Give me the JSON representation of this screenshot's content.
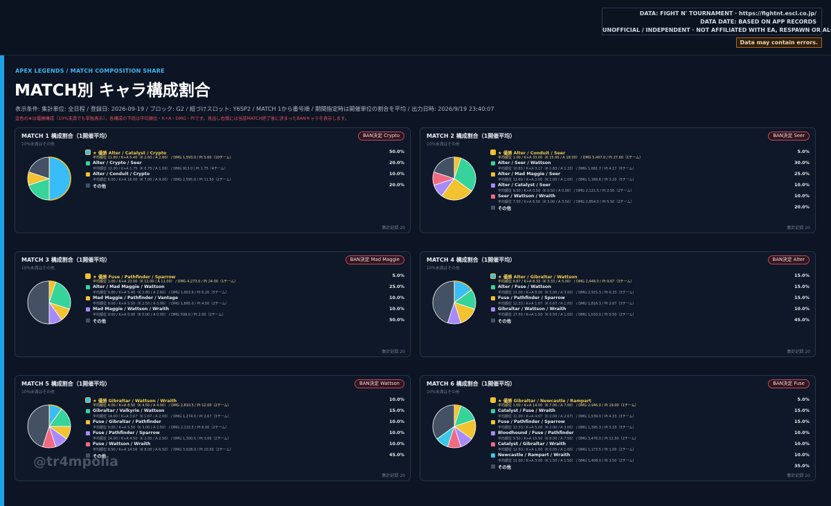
{
  "header": {
    "credit_lines": [
      "DATA: FIGHT N' TOURNAMENT · https://fightnt.escl.co.jp/",
      "DATA DATE: BASED ON APP RECORDS",
      "UNOFFICIAL / INDEPENDENT · NOT AFFILIATED WITH EA, RESPAWN OR ALGS"
    ],
    "warning": "Data may contain errors.",
    "eyebrow": "APEX LEGENDS / MATCH COMPOSITION SHARE",
    "title": "MATCH別 キャラ構成割合",
    "conditions": "表示条件: 集計単位: 全日程 / 登録日: 2026-09-19 / ブロック: G2 / 紐づけスロット: Y6SP2 / MATCH 1から番号順 / 期間指定時は開催単位の割合を平均 / 出力日時: 2026/9/19 23:40:07",
    "note": "金色の★は優勝構成（10%未満でも単独表示）。各構成の下段は平均順位・K+A・DMG・Ptです。見出し右側には当該MATCH終了後に決まったBANキャラを表示します。"
  },
  "watermark": "@tr4mpolia",
  "colors": {
    "winner": "#f2c230",
    "other": "#445164",
    "slice_border": "#ffffff",
    "c1": "#36d39a",
    "c2": "#f2c230",
    "c3": "#a78bfa",
    "c4": "#f06a82",
    "c5": "#3bc7e6",
    "sky": "#38bdf8"
  },
  "chart_data": [
    {
      "type": "pie",
      "title": "MATCH 1 構成割合（1開催平均）",
      "subtitle": "10%未満はその他",
      "ban": "BAN決定  Crypto",
      "footer": "集計記録 20",
      "slices": [
        {
          "label": "★ 優勝  Alter / Catalyst / Crypto",
          "stats": "平均順位 11.80 / K+A 5.40（K 2.60 / A 2.80） / DMG 1,593.0 / Pt 5.60（10チーム）",
          "pct_text": "50.0%",
          "value": 50,
          "color": "sky",
          "winner": true
        },
        {
          "label": "Alter / Crypto / Seer",
          "stats": "平均順位 12.00 / K+A 1.75（K 0.75 / A 1.00） / DMG 913.0 / Pt 1.75（4チーム）",
          "pct_text": "20.0%",
          "value": 20,
          "color": "c1"
        },
        {
          "label": "Alter / Conduit / Crypto",
          "stats": "平均順位 6.00 / K+A 16.00（K 7.00 / A 9.00） / DMG 2,595.0 / Pt 11.50（2チーム）",
          "pct_text": "10.0%",
          "value": 10,
          "color": "c2"
        },
        {
          "label": "その他",
          "stats": "",
          "pct_text": "20.0%",
          "value": 20,
          "color": "other",
          "other": true
        }
      ]
    },
    {
      "type": "pie",
      "title": "MATCH 2 構成割合（1開催平均）",
      "subtitle": "10%未満はその他",
      "ban": "BAN決定  Seer",
      "footer": "集計記録 20",
      "slices": [
        {
          "label": "★ 優勝  Alter / Conduit / Seer",
          "stats": "平均順位 1.00 / K+A 33.00（K 15.00 / A 18.00） / DMG 5,407.0 / Pt 27.00（1チーム）",
          "pct_text": "5.0%",
          "value": 5,
          "color": "winner",
          "winner": true
        },
        {
          "label": "Alter / Seer / Wattson",
          "stats": "平均順位 10.83 / K+A 3.17（K 1.83 / A 1.33） / DMG 1,681.7 / Pt 4.17（6チーム）",
          "pct_text": "30.0%",
          "value": 30,
          "color": "c1"
        },
        {
          "label": "Alter / Mad Maggie / Seer",
          "stats": "平均順位 13.60 / K+A 2.00（K 1.00 / A 1.00） / DMG 1,169.6 / Pt 3.20（5チーム）",
          "pct_text": "25.0%",
          "value": 25,
          "color": "c2"
        },
        {
          "label": "Alter / Catalyst / Seer",
          "stats": "平均順位 9.50 / K+A 0.50（K 0.50 / A 0.00） / DMG 2,121.5 / Pt 2.50（2チーム）",
          "pct_text": "10.0%",
          "value": 10,
          "color": "c3"
        },
        {
          "label": "Seer / Wattson / Wraith",
          "stats": "平均順位 7.50 / K+A 6.50（K 3.00 / A 3.50） / DMG 2,854.0 / Pt 5.50（2チーム）",
          "pct_text": "10.0%",
          "value": 10,
          "color": "c4"
        },
        {
          "label": "その他",
          "stats": "",
          "pct_text": "20.0%",
          "value": 20,
          "color": "other",
          "other": true
        }
      ]
    },
    {
      "type": "pie",
      "title": "MATCH 3 構成割合（1開催平均）",
      "subtitle": "10%未満はその他",
      "ban": "BAN決定  Mad Maggie",
      "footer": "集計記録 20",
      "slices": [
        {
          "label": "★ 優勝  Fuse / Pathfinder / Sparrow",
          "stats": "平均順位 1.00 / K+A 23.00（K 12.00 / A 11.00） / DMG 4,273.0 / Pt 24.00（1チーム）",
          "pct_text": "5.0%",
          "value": 5,
          "color": "winner",
          "winner": true
        },
        {
          "label": "Alter / Mad Maggie / Wattson",
          "stats": "平均順位 9.80 / K+A 5.40（K 2.80 / A 2.60） / DMG 1,903.6 / Pt 6.20（5チーム）",
          "pct_text": "25.0%",
          "value": 25,
          "color": "c1"
        },
        {
          "label": "Mad Maggie / Pathfinder / Vantage",
          "stats": "平均順位 9.00 / K+A 5.50（K 2.50 / A 3.00） / DMG 1,895.0 / Pt 4.50（2チーム）",
          "pct_text": "10.0%",
          "value": 10,
          "color": "c2"
        },
        {
          "label": "Mad Maggie / Wattson / Wraith",
          "stats": "平均順位 9.00 / K+A 0.00（K 0.00 / A 0.00） / DMG 599.0 / Pt 2.00（2チーム）",
          "pct_text": "10.0%",
          "value": 10,
          "color": "c3"
        },
        {
          "label": "その他",
          "stats": "",
          "pct_text": "50.0%",
          "value": 50,
          "color": "other",
          "other": true
        }
      ]
    },
    {
      "type": "pie",
      "title": "MATCH 4 構成割合（1開催平均）",
      "subtitle": "10%未満はその他",
      "ban": "BAN決定  Alter",
      "footer": "集計記録 20",
      "slices": [
        {
          "label": "★ 優勝  Alter / Gibraltar / Wattson",
          "stats": "平均順位 6.67 / K+A 8.33（K 3.33 / A 5.00） / DMG 2,448.0 / Pt 9.67（3チーム）",
          "pct_text": "15.0%",
          "value": 15,
          "color": "sky",
          "winner": true
        },
        {
          "label": "Alter / Fuse / Wattson",
          "stats": "平均順位 11.00 / K+A 8.00（K 5.00 / A 3.00） / DMG 2,915.3 / Pt 6.33（3チーム）",
          "pct_text": "15.0%",
          "value": 15,
          "color": "c1"
        },
        {
          "label": "Fuse / Pathfinder / Sparrow",
          "stats": "平均順位 12.33 / K+A 1.67（K 0.67 / A 1.00） / DMG 1,816.3 / Pt 2.67（3チーム）",
          "pct_text": "15.0%",
          "value": 15,
          "color": "c2"
        },
        {
          "label": "Gibraltar / Wattson / Wraith",
          "stats": "平均順位 17.50 / K+A 1.50（K 0.50 / A 1.00） / DMG 1,033.0 / Pt 0.50（2チーム）",
          "pct_text": "10.0%",
          "value": 10,
          "color": "c3"
        },
        {
          "label": "その他",
          "stats": "",
          "pct_text": "45.0%",
          "value": 45,
          "color": "other",
          "other": true
        }
      ]
    },
    {
      "type": "pie",
      "title": "MATCH 5 構成割合（1開催平均）",
      "subtitle": "10%未満はその他",
      "ban": "BAN決定  Wattson",
      "footer": "集計記録 20",
      "slices": [
        {
          "label": "★ 優勝  Gibraltar / Wattson / Wraith",
          "stats": "平均順位 4.00 / K+A 8.50（K 4.50 / A 4.00） / DMG 2,810.5 / Pt 12.00（2チーム）",
          "pct_text": "10.0%",
          "value": 10,
          "color": "sky",
          "winner": true
        },
        {
          "label": "Gibraltar / Valkyrie / Wattson",
          "stats": "平均順位 14.00 / K+A 3.67（K 1.67 / A 2.00） / DMG 1,274.0 / Pt 2.67（3チーム）",
          "pct_text": "15.0%",
          "value": 15,
          "color": "c1"
        },
        {
          "label": "Fuse / Gibraltar / Pathfinder",
          "stats": "平均順位 9.00 / K+A 5.50（K 3.00 / A 2.50） / DMG 2,115.5 / Pt 6.00（2チーム）",
          "pct_text": "10.0%",
          "value": 10,
          "color": "c2"
        },
        {
          "label": "Fuse / Pathfinder / Sparrow",
          "stats": "平均順位 14.00 / K+A 4.50（K 2.00 / A 2.50） / DMG 1,300.5 / Pt 3.00（2チーム）",
          "pct_text": "10.0%",
          "value": 10,
          "color": "c3"
        },
        {
          "label": "Fuse / Wattson / Wraith",
          "stats": "平均順位 8.50 / K+A 14.50（K 8.00 / A 6.50） / DMG 3,928.0 / Pt 10.50（2チーム）",
          "pct_text": "10.0%",
          "value": 10,
          "color": "c4"
        },
        {
          "label": "その他",
          "stats": "",
          "pct_text": "45.0%",
          "value": 45,
          "color": "other",
          "other": true
        }
      ]
    },
    {
      "type": "pie",
      "title": "MATCH 6 構成割合（1開催平均）",
      "subtitle": "10%未満はその他",
      "ban": "BAN決定  Fuse",
      "footer": "集計記録 20",
      "slices": [
        {
          "label": "★ 優勝  Gibraltar / Newcastle / Rampart",
          "stats": "平均順位 1.00 / K+A 14.00（K 7.00 / A 7.00） / DMG 2,946.0 / Pt 19.00（1チーム）",
          "pct_text": "5.0%",
          "value": 5,
          "color": "winner",
          "winner": true
        },
        {
          "label": "Catalyst / Fuse / Wraith",
          "stats": "平均順位 11.00 / K+A 4.67（K 2.00 / A 2.67） / DMG 1,539.0 / Pt 4.33（3チーム）",
          "pct_text": "15.0%",
          "value": 15,
          "color": "c1"
        },
        {
          "label": "Fuse / Pathfinder / Sparrow",
          "stats": "平均順位 12.33 / K+A 5.00（K 2.00 / A 3.00） / DMG 1,395.3 / Pt 3.33（3チーム）",
          "pct_text": "15.0%",
          "value": 15,
          "color": "c2"
        },
        {
          "label": "Bloodhound / Fuse / Pathfinder",
          "stats": "平均順位 9.50 / K+A 15.50（K 8.00 / A 7.50） / DMG 3,476.0 / Pt 11.50（2チーム）",
          "pct_text": "10.0%",
          "value": 10,
          "color": "c3"
        },
        {
          "label": "Catalyst / Gibraltar / Wraith",
          "stats": "平均順位 12.50 / K+A 1.00（K 0.00 / A 1.00） / DMG 1,173.5 / Pt 1.00（2チーム）",
          "pct_text": "10.0%",
          "value": 10,
          "color": "c4"
        },
        {
          "label": "Newcastle / Rampart / Wraith",
          "stats": "平均順位 11.00 / K+A 3.00（K 1.50 / A 1.50） / DMG 1,408.0 / Pt 3.50（2チーム）",
          "pct_text": "10.0%",
          "value": 10,
          "color": "c5"
        },
        {
          "label": "その他",
          "stats": "",
          "pct_text": "35.0%",
          "value": 35,
          "color": "other",
          "other": true
        }
      ]
    }
  ]
}
